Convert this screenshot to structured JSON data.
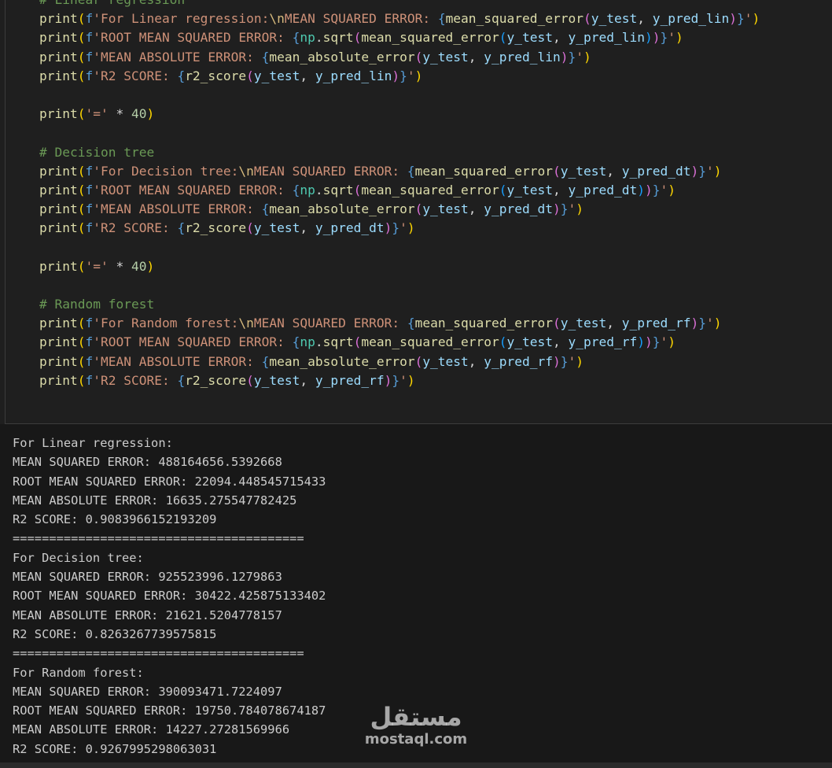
{
  "code": {
    "lines": [
      [
        {
          "t": "# Linear regression",
          "c": "comment"
        }
      ],
      [
        {
          "t": "print",
          "c": "fn"
        },
        {
          "t": "(",
          "c": "b1"
        },
        {
          "t": "f",
          "c": "fmt"
        },
        {
          "t": "'For Linear regression:",
          "c": "str"
        },
        {
          "t": "\\n",
          "c": "esc"
        },
        {
          "t": "MEAN SQUARED ERROR: ",
          "c": "str"
        },
        {
          "t": "{",
          "c": "fmt"
        },
        {
          "t": "mean_squared_error",
          "c": "fn"
        },
        {
          "t": "(",
          "c": "b2"
        },
        {
          "t": "y_test",
          "c": "var"
        },
        {
          "t": ", ",
          "c": "op"
        },
        {
          "t": "y_pred_lin",
          "c": "var"
        },
        {
          "t": ")",
          "c": "b2"
        },
        {
          "t": "}",
          "c": "fmt"
        },
        {
          "t": "'",
          "c": "str"
        },
        {
          "t": ")",
          "c": "b1"
        }
      ],
      [
        {
          "t": "print",
          "c": "fn"
        },
        {
          "t": "(",
          "c": "b1"
        },
        {
          "t": "f",
          "c": "fmt"
        },
        {
          "t": "'ROOT MEAN SQUARED ERROR: ",
          "c": "str"
        },
        {
          "t": "{",
          "c": "fmt"
        },
        {
          "t": "np",
          "c": "mod"
        },
        {
          "t": ".",
          "c": "op"
        },
        {
          "t": "sqrt",
          "c": "fn"
        },
        {
          "t": "(",
          "c": "b2"
        },
        {
          "t": "mean_squared_error",
          "c": "fn"
        },
        {
          "t": "(",
          "c": "b3"
        },
        {
          "t": "y_test",
          "c": "var"
        },
        {
          "t": ", ",
          "c": "op"
        },
        {
          "t": "y_pred_lin",
          "c": "var"
        },
        {
          "t": ")",
          "c": "b3"
        },
        {
          "t": ")",
          "c": "b2"
        },
        {
          "t": "}",
          "c": "fmt"
        },
        {
          "t": "'",
          "c": "str"
        },
        {
          "t": ")",
          "c": "b1"
        }
      ],
      [
        {
          "t": "print",
          "c": "fn"
        },
        {
          "t": "(",
          "c": "b1"
        },
        {
          "t": "f",
          "c": "fmt"
        },
        {
          "t": "'MEAN ABSOLUTE ERROR: ",
          "c": "str"
        },
        {
          "t": "{",
          "c": "fmt"
        },
        {
          "t": "mean_absolute_error",
          "c": "fn"
        },
        {
          "t": "(",
          "c": "b2"
        },
        {
          "t": "y_test",
          "c": "var"
        },
        {
          "t": ", ",
          "c": "op"
        },
        {
          "t": "y_pred_lin",
          "c": "var"
        },
        {
          "t": ")",
          "c": "b2"
        },
        {
          "t": "}",
          "c": "fmt"
        },
        {
          "t": "'",
          "c": "str"
        },
        {
          "t": ")",
          "c": "b1"
        }
      ],
      [
        {
          "t": "print",
          "c": "fn"
        },
        {
          "t": "(",
          "c": "b1"
        },
        {
          "t": "f",
          "c": "fmt"
        },
        {
          "t": "'R2 SCORE: ",
          "c": "str"
        },
        {
          "t": "{",
          "c": "fmt"
        },
        {
          "t": "r2_score",
          "c": "fn"
        },
        {
          "t": "(",
          "c": "b2"
        },
        {
          "t": "y_test",
          "c": "var"
        },
        {
          "t": ", ",
          "c": "op"
        },
        {
          "t": "y_pred_lin",
          "c": "var"
        },
        {
          "t": ")",
          "c": "b2"
        },
        {
          "t": "}",
          "c": "fmt"
        },
        {
          "t": "'",
          "c": "str"
        },
        {
          "t": ")",
          "c": "b1"
        }
      ],
      [],
      [
        {
          "t": "print",
          "c": "fn"
        },
        {
          "t": "(",
          "c": "b1"
        },
        {
          "t": "'='",
          "c": "str"
        },
        {
          "t": " * ",
          "c": "op"
        },
        {
          "t": "40",
          "c": "num"
        },
        {
          "t": ")",
          "c": "b1"
        }
      ],
      [],
      [
        {
          "t": "# Decision tree",
          "c": "comment"
        }
      ],
      [
        {
          "t": "print",
          "c": "fn"
        },
        {
          "t": "(",
          "c": "b1"
        },
        {
          "t": "f",
          "c": "fmt"
        },
        {
          "t": "'For Decision tree:",
          "c": "str"
        },
        {
          "t": "\\n",
          "c": "esc"
        },
        {
          "t": "MEAN SQUARED ERROR: ",
          "c": "str"
        },
        {
          "t": "{",
          "c": "fmt"
        },
        {
          "t": "mean_squared_error",
          "c": "fn"
        },
        {
          "t": "(",
          "c": "b2"
        },
        {
          "t": "y_test",
          "c": "var"
        },
        {
          "t": ", ",
          "c": "op"
        },
        {
          "t": "y_pred_dt",
          "c": "var"
        },
        {
          "t": ")",
          "c": "b2"
        },
        {
          "t": "}",
          "c": "fmt"
        },
        {
          "t": "'",
          "c": "str"
        },
        {
          "t": ")",
          "c": "b1"
        }
      ],
      [
        {
          "t": "print",
          "c": "fn"
        },
        {
          "t": "(",
          "c": "b1"
        },
        {
          "t": "f",
          "c": "fmt"
        },
        {
          "t": "'ROOT MEAN SQUARED ERROR: ",
          "c": "str"
        },
        {
          "t": "{",
          "c": "fmt"
        },
        {
          "t": "np",
          "c": "mod"
        },
        {
          "t": ".",
          "c": "op"
        },
        {
          "t": "sqrt",
          "c": "fn"
        },
        {
          "t": "(",
          "c": "b2"
        },
        {
          "t": "mean_squared_error",
          "c": "fn"
        },
        {
          "t": "(",
          "c": "b3"
        },
        {
          "t": "y_test",
          "c": "var"
        },
        {
          "t": ", ",
          "c": "op"
        },
        {
          "t": "y_pred_dt",
          "c": "var"
        },
        {
          "t": ")",
          "c": "b3"
        },
        {
          "t": ")",
          "c": "b2"
        },
        {
          "t": "}",
          "c": "fmt"
        },
        {
          "t": "'",
          "c": "str"
        },
        {
          "t": ")",
          "c": "b1"
        }
      ],
      [
        {
          "t": "print",
          "c": "fn"
        },
        {
          "t": "(",
          "c": "b1"
        },
        {
          "t": "f",
          "c": "fmt"
        },
        {
          "t": "'MEAN ABSOLUTE ERROR: ",
          "c": "str"
        },
        {
          "t": "{",
          "c": "fmt"
        },
        {
          "t": "mean_absolute_error",
          "c": "fn"
        },
        {
          "t": "(",
          "c": "b2"
        },
        {
          "t": "y_test",
          "c": "var"
        },
        {
          "t": ", ",
          "c": "op"
        },
        {
          "t": "y_pred_dt",
          "c": "var"
        },
        {
          "t": ")",
          "c": "b2"
        },
        {
          "t": "}",
          "c": "fmt"
        },
        {
          "t": "'",
          "c": "str"
        },
        {
          "t": ")",
          "c": "b1"
        }
      ],
      [
        {
          "t": "print",
          "c": "fn"
        },
        {
          "t": "(",
          "c": "b1"
        },
        {
          "t": "f",
          "c": "fmt"
        },
        {
          "t": "'R2 SCORE: ",
          "c": "str"
        },
        {
          "t": "{",
          "c": "fmt"
        },
        {
          "t": "r2_score",
          "c": "fn"
        },
        {
          "t": "(",
          "c": "b2"
        },
        {
          "t": "y_test",
          "c": "var"
        },
        {
          "t": ", ",
          "c": "op"
        },
        {
          "t": "y_pred_dt",
          "c": "var"
        },
        {
          "t": ")",
          "c": "b2"
        },
        {
          "t": "}",
          "c": "fmt"
        },
        {
          "t": "'",
          "c": "str"
        },
        {
          "t": ")",
          "c": "b1"
        }
      ],
      [],
      [
        {
          "t": "print",
          "c": "fn"
        },
        {
          "t": "(",
          "c": "b1"
        },
        {
          "t": "'='",
          "c": "str"
        },
        {
          "t": " * ",
          "c": "op"
        },
        {
          "t": "40",
          "c": "num"
        },
        {
          "t": ")",
          "c": "b1"
        }
      ],
      [],
      [
        {
          "t": "# Random forest",
          "c": "comment"
        }
      ],
      [
        {
          "t": "print",
          "c": "fn"
        },
        {
          "t": "(",
          "c": "b1"
        },
        {
          "t": "f",
          "c": "fmt"
        },
        {
          "t": "'For Random forest:",
          "c": "str"
        },
        {
          "t": "\\n",
          "c": "esc"
        },
        {
          "t": "MEAN SQUARED ERROR: ",
          "c": "str"
        },
        {
          "t": "{",
          "c": "fmt"
        },
        {
          "t": "mean_squared_error",
          "c": "fn"
        },
        {
          "t": "(",
          "c": "b2"
        },
        {
          "t": "y_test",
          "c": "var"
        },
        {
          "t": ", ",
          "c": "op"
        },
        {
          "t": "y_pred_rf",
          "c": "var"
        },
        {
          "t": ")",
          "c": "b2"
        },
        {
          "t": "}",
          "c": "fmt"
        },
        {
          "t": "'",
          "c": "str"
        },
        {
          "t": ")",
          "c": "b1"
        }
      ],
      [
        {
          "t": "print",
          "c": "fn"
        },
        {
          "t": "(",
          "c": "b1"
        },
        {
          "t": "f",
          "c": "fmt"
        },
        {
          "t": "'ROOT MEAN SQUARED ERROR: ",
          "c": "str"
        },
        {
          "t": "{",
          "c": "fmt"
        },
        {
          "t": "np",
          "c": "mod"
        },
        {
          "t": ".",
          "c": "op"
        },
        {
          "t": "sqrt",
          "c": "fn"
        },
        {
          "t": "(",
          "c": "b2"
        },
        {
          "t": "mean_squared_error",
          "c": "fn"
        },
        {
          "t": "(",
          "c": "b3"
        },
        {
          "t": "y_test",
          "c": "var"
        },
        {
          "t": ", ",
          "c": "op"
        },
        {
          "t": "y_pred_rf",
          "c": "var"
        },
        {
          "t": ")",
          "c": "b3"
        },
        {
          "t": ")",
          "c": "b2"
        },
        {
          "t": "}",
          "c": "fmt"
        },
        {
          "t": "'",
          "c": "str"
        },
        {
          "t": ")",
          "c": "b1"
        }
      ],
      [
        {
          "t": "print",
          "c": "fn"
        },
        {
          "t": "(",
          "c": "b1"
        },
        {
          "t": "f",
          "c": "fmt"
        },
        {
          "t": "'MEAN ABSOLUTE ERROR: ",
          "c": "str"
        },
        {
          "t": "{",
          "c": "fmt"
        },
        {
          "t": "mean_absolute_error",
          "c": "fn"
        },
        {
          "t": "(",
          "c": "b2"
        },
        {
          "t": "y_test",
          "c": "var"
        },
        {
          "t": ", ",
          "c": "op"
        },
        {
          "t": "y_pred_rf",
          "c": "var"
        },
        {
          "t": ")",
          "c": "b2"
        },
        {
          "t": "}",
          "c": "fmt"
        },
        {
          "t": "'",
          "c": "str"
        },
        {
          "t": ")",
          "c": "b1"
        }
      ],
      [
        {
          "t": "print",
          "c": "fn"
        },
        {
          "t": "(",
          "c": "b1"
        },
        {
          "t": "f",
          "c": "fmt"
        },
        {
          "t": "'R2 SCORE: ",
          "c": "str"
        },
        {
          "t": "{",
          "c": "fmt"
        },
        {
          "t": "r2_score",
          "c": "fn"
        },
        {
          "t": "(",
          "c": "b2"
        },
        {
          "t": "y_test",
          "c": "var"
        },
        {
          "t": ", ",
          "c": "op"
        },
        {
          "t": "y_pred_rf",
          "c": "var"
        },
        {
          "t": ")",
          "c": "b2"
        },
        {
          "t": "}",
          "c": "fmt"
        },
        {
          "t": "'",
          "c": "str"
        },
        {
          "t": ")",
          "c": "b1"
        }
      ]
    ]
  },
  "output": {
    "lines": [
      "For Linear regression:",
      "MEAN SQUARED ERROR: 488164656.5392668",
      "ROOT MEAN SQUARED ERROR: 22094.448545715433",
      "MEAN ABSOLUTE ERROR: 16635.275547782425",
      "R2 SCORE: 0.9083966152193209",
      "========================================",
      "For Decision tree:",
      "MEAN SQUARED ERROR: 925523996.1279863",
      "ROOT MEAN SQUARED ERROR: 30422.425875133402",
      "MEAN ABSOLUTE ERROR: 21621.5204778157",
      "R2 SCORE: 0.8263267739575815",
      "========================================",
      "For Random forest:",
      "MEAN SQUARED ERROR: 390093471.7224097",
      "ROOT MEAN SQUARED ERROR: 19750.784078674187",
      "MEAN ABSOLUTE ERROR: 14227.27281569966",
      "R2 SCORE: 0.9267995298063031"
    ]
  },
  "watermark": {
    "arabic": "مستقل",
    "latin": "mostaql.com"
  },
  "colors": {
    "editor_background": "#1f1f1f",
    "output_background": "#181818",
    "text": "#cccccc"
  }
}
